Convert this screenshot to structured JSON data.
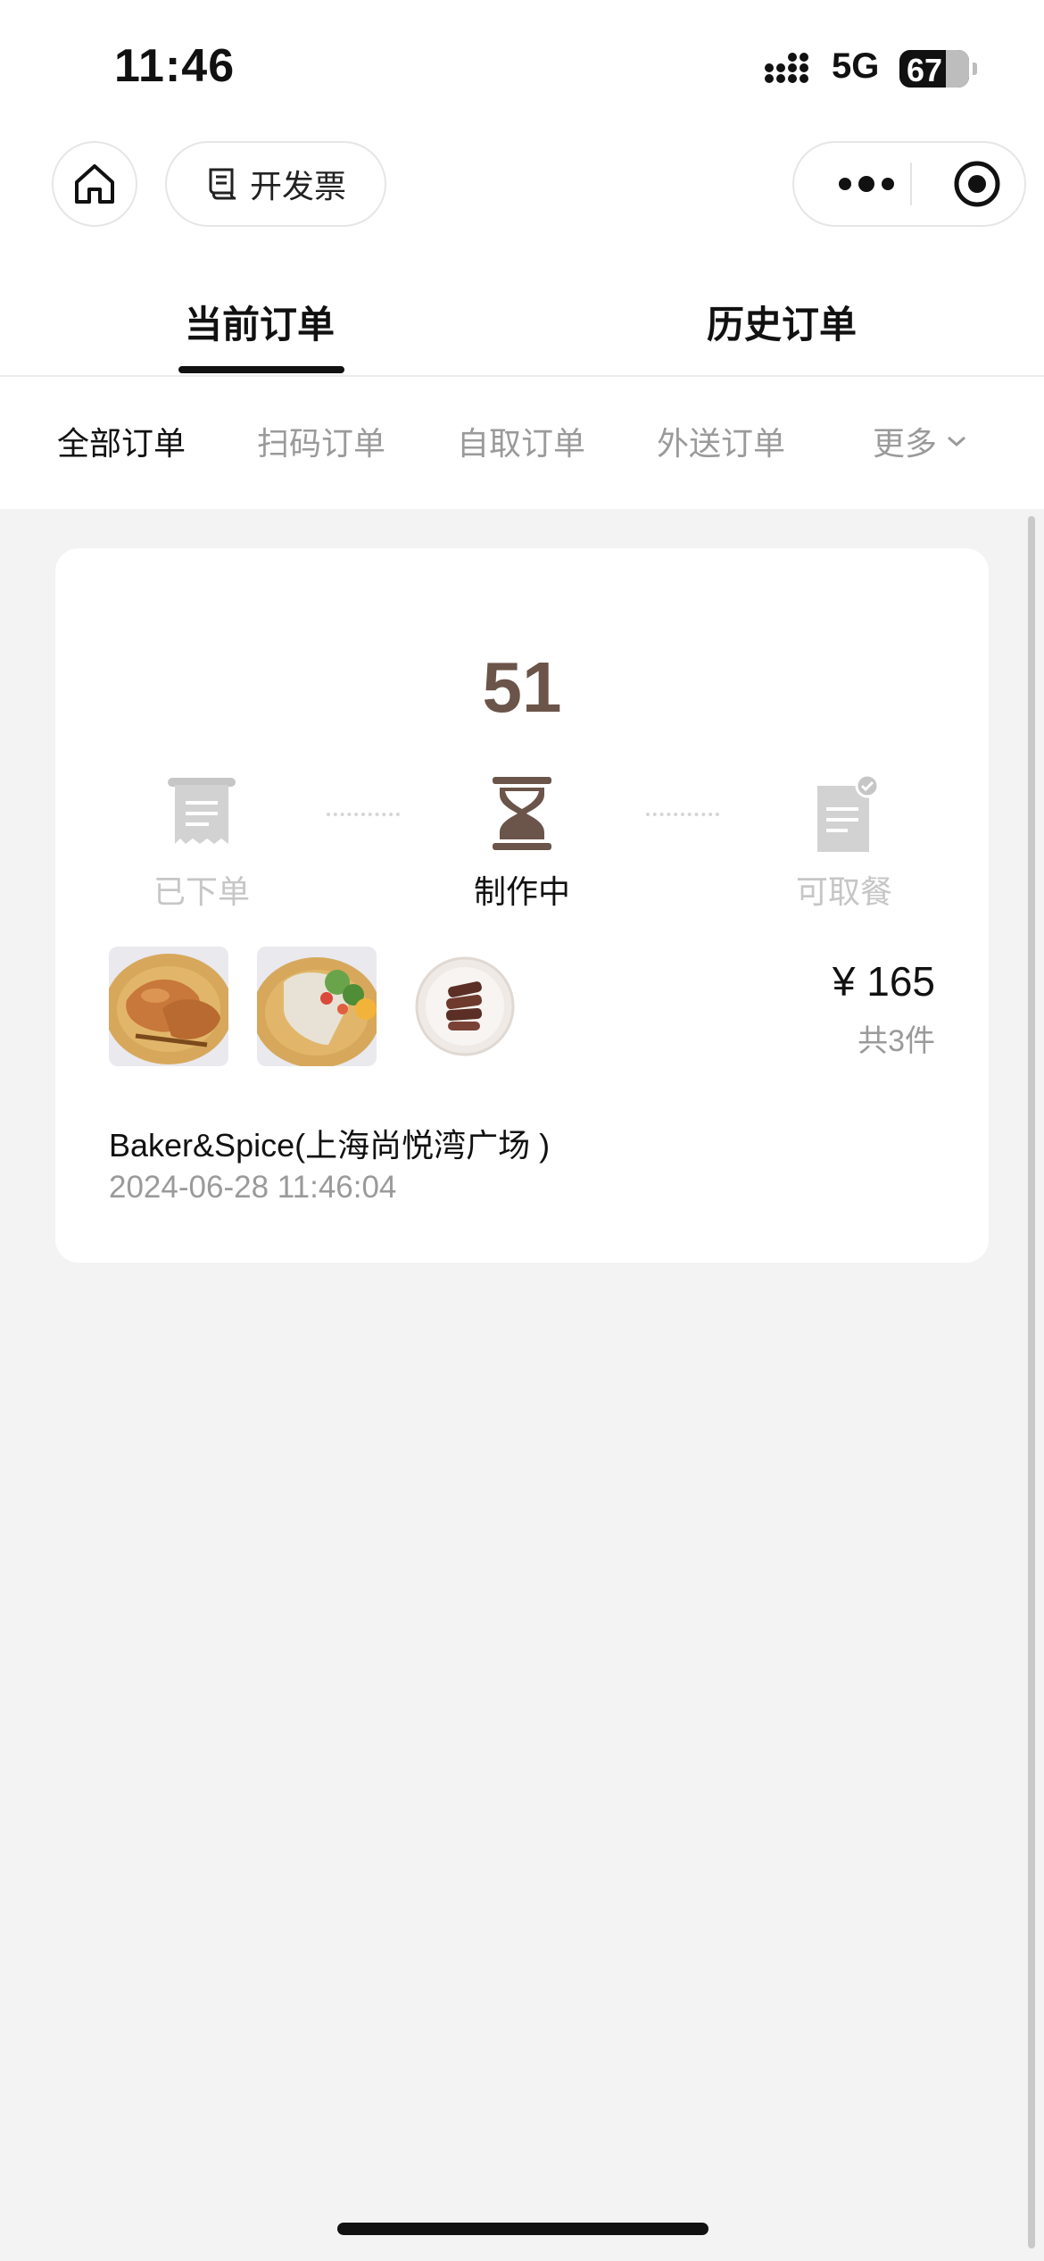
{
  "status_bar": {
    "time": "11:46",
    "network": "5G",
    "battery": "67"
  },
  "nav": {
    "invoice_label": "开发票"
  },
  "tabs": [
    {
      "label": "当前订单",
      "active": true
    },
    {
      "label": "历史订单",
      "active": false
    }
  ],
  "filters": [
    {
      "label": "全部订单",
      "active": true
    },
    {
      "label": "扫码订单",
      "active": false
    },
    {
      "label": "自取订单",
      "active": false
    },
    {
      "label": "外送订单",
      "active": false
    },
    {
      "label": "更多",
      "active": false
    }
  ],
  "order": {
    "number": "51",
    "steps": [
      {
        "label": "已下单",
        "icon": "receipt-icon",
        "active": false
      },
      {
        "label": "制作中",
        "icon": "hourglass-icon",
        "active": true
      },
      {
        "label": "可取餐",
        "icon": "ready-document-icon",
        "active": false
      }
    ],
    "items": [
      {
        "name": "roast-chicken-image"
      },
      {
        "name": "salad-roll-image"
      },
      {
        "name": "sliced-steak-image"
      }
    ],
    "price": "¥ 165",
    "count": "共3件",
    "store": "Baker&Spice(上海尚悦湾广场 )",
    "time": "2024-06-28 11:46:04"
  },
  "colors": {
    "accent_brown": "#6b5449",
    "inactive": "#c6c6c6",
    "background": "#f3f3f3"
  }
}
